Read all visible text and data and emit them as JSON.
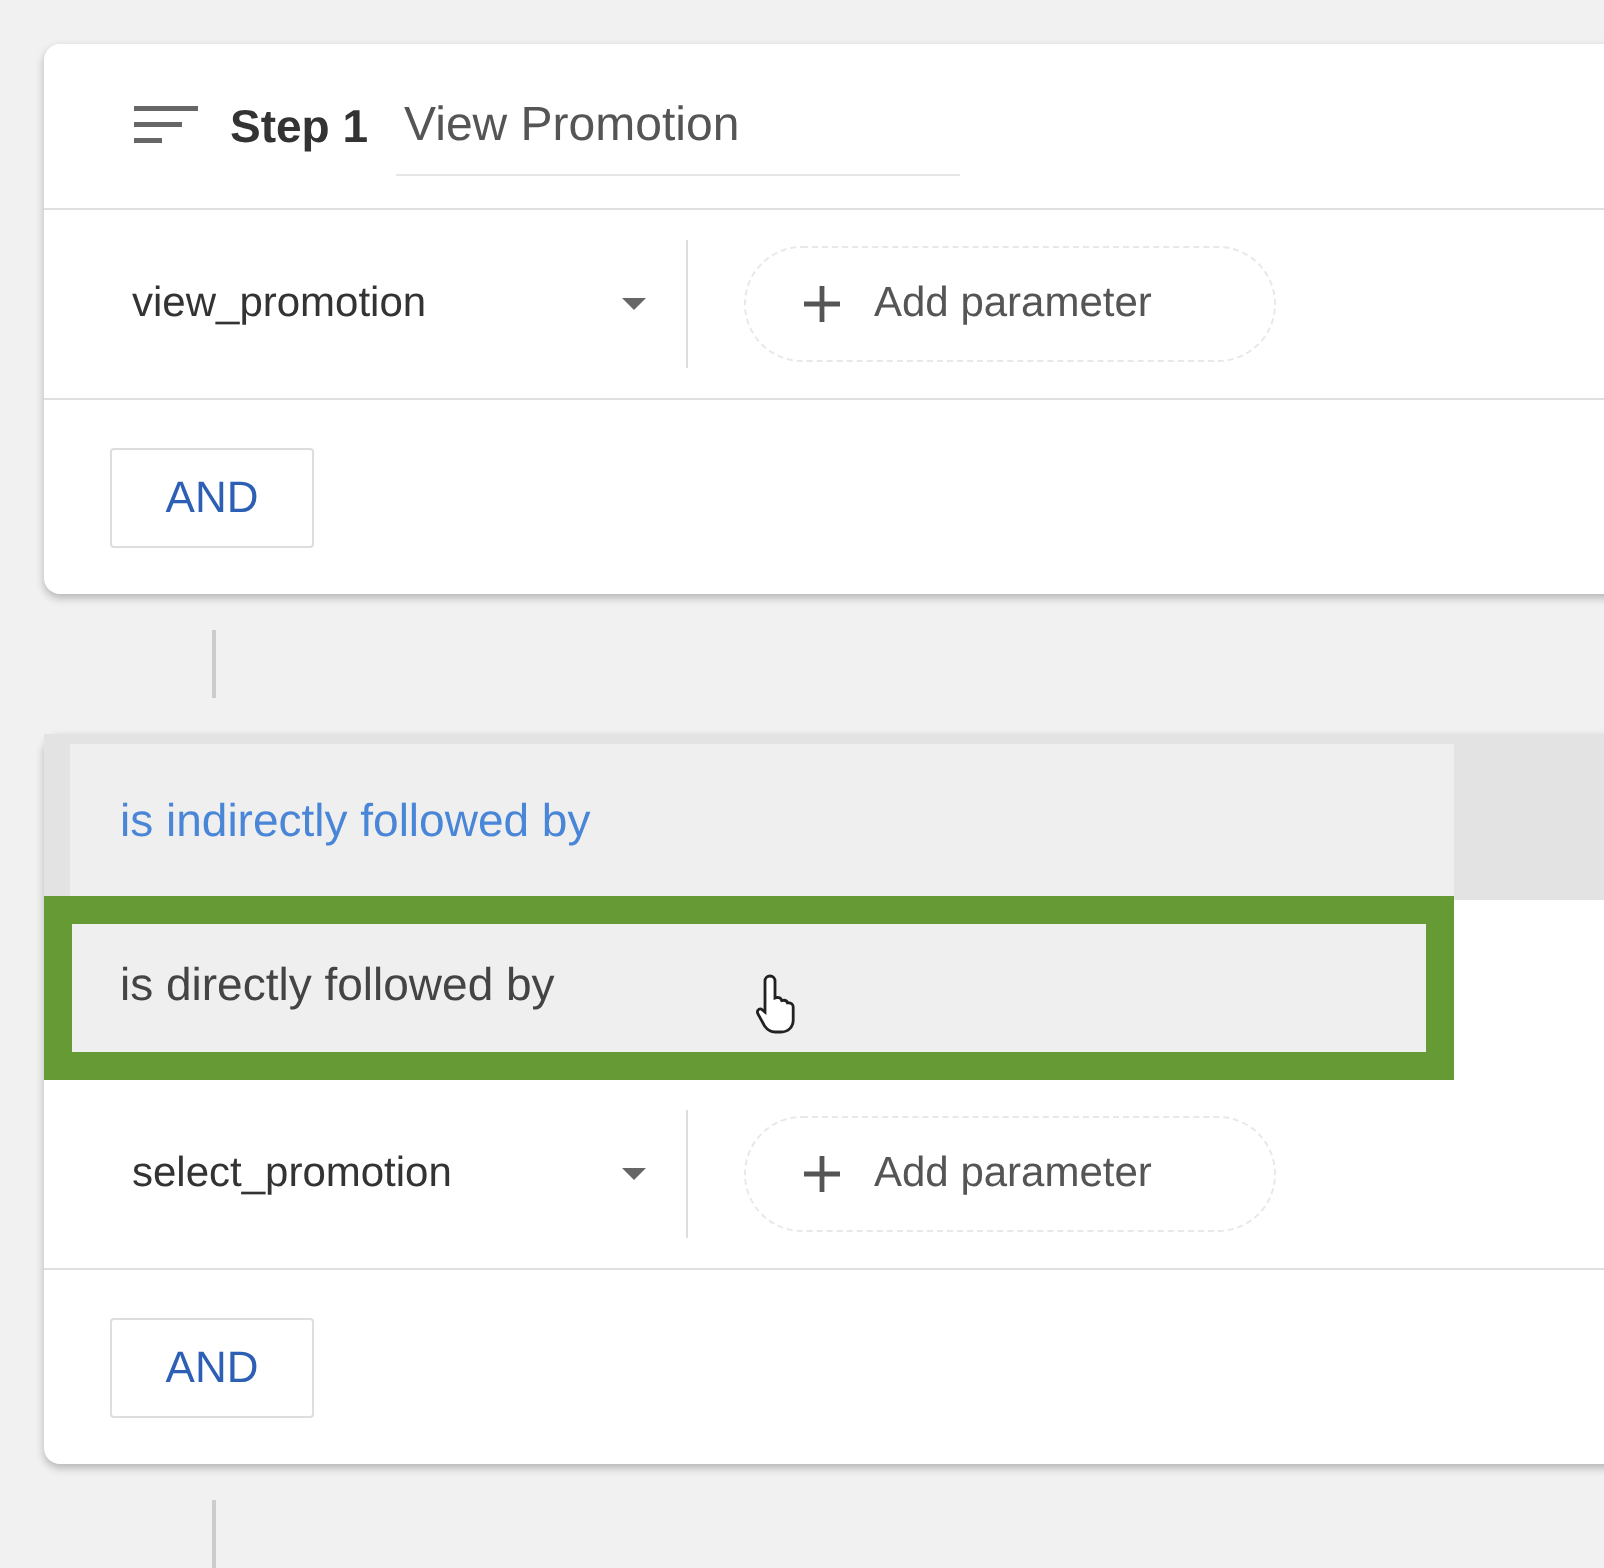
{
  "steps": [
    {
      "label": "Step 1",
      "name": "View Promotion",
      "event": "view_promotion",
      "add_parameter": "Add parameter",
      "and_button": "AND"
    },
    {
      "event": "select_promotion",
      "add_parameter": "Add parameter",
      "and_button": "AND"
    }
  ],
  "relation_menu": {
    "options": [
      {
        "label": "is indirectly followed by",
        "selected": true,
        "highlighted": false
      },
      {
        "label": "is directly followed by",
        "selected": false,
        "highlighted": true
      }
    ]
  }
}
